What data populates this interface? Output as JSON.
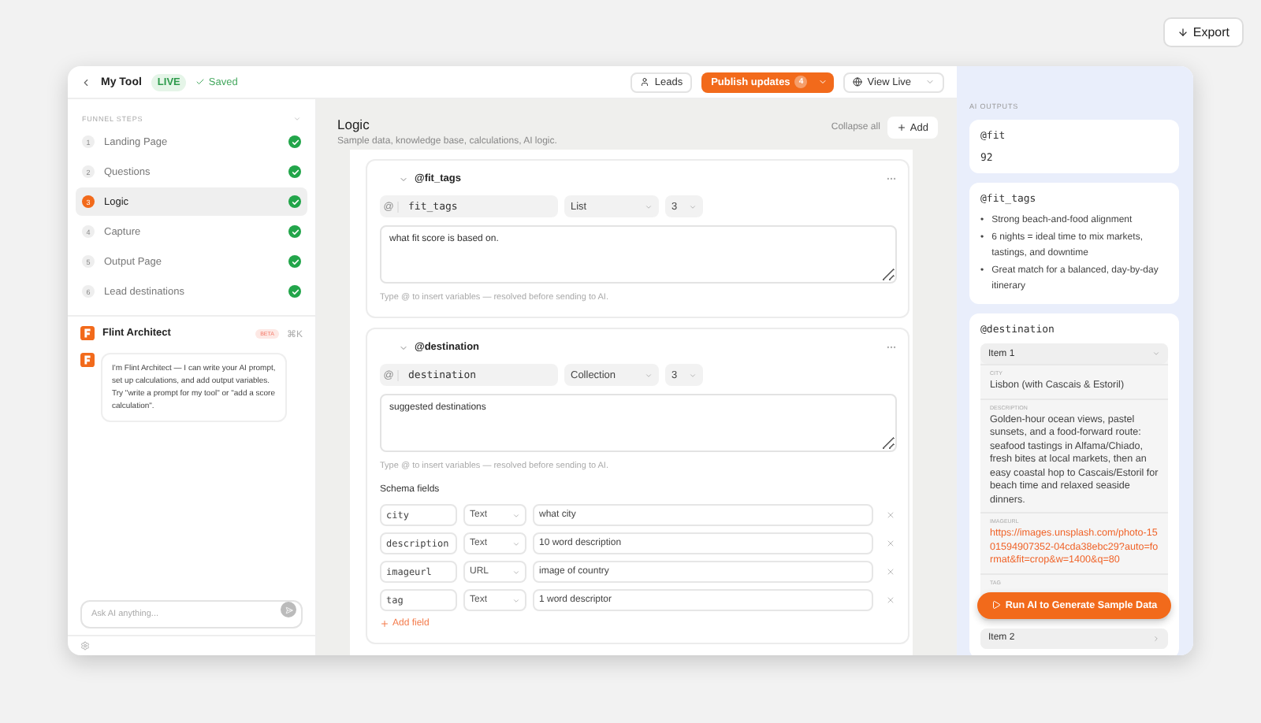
{
  "export_button": "Export",
  "header": {
    "title": "My Tool",
    "status": "LIVE",
    "saved": "Saved",
    "leads": "Leads",
    "publish": "Publish updates",
    "publish_count": "4",
    "view_live": "View Live"
  },
  "sidebar": {
    "section_title": "FUNNEL STEPS",
    "steps": [
      {
        "number": "1",
        "label": "Landing Page",
        "selected": false,
        "done": true
      },
      {
        "number": "2",
        "label": "Questions",
        "selected": false,
        "done": true
      },
      {
        "number": "3",
        "label": "Logic",
        "selected": true,
        "done": true
      },
      {
        "number": "4",
        "label": "Capture",
        "selected": false,
        "done": true
      },
      {
        "number": "5",
        "label": "Output Page",
        "selected": false,
        "done": true
      },
      {
        "number": "6",
        "label": "Lead destinations",
        "selected": false,
        "done": true
      }
    ],
    "assistant": {
      "name": "Flint Architect",
      "badge": "BETA",
      "shortcut": "⌘K",
      "message": "I'm Flint Architect — I can write your AI prompt, set up calculations, and add output variables. Try \"write a prompt for my tool\" or \"add a score calculation\".",
      "input_placeholder": "Ask AI anything..."
    }
  },
  "main": {
    "title": "Logic",
    "subtitle": "Sample data, knowledge base, calculations, AI logic.",
    "collapse_all": "Collapse all",
    "add": "Add",
    "variables": [
      {
        "kind": "list",
        "title": "@fit_tags",
        "at_sign": "@",
        "name": "fit_tags",
        "type": "List",
        "count": "3",
        "prompt": "what fit score is based on.",
        "hint": "Type @ to insert variables — resolved before sending to AI."
      },
      {
        "kind": "collection",
        "title": "@destination",
        "at_sign": "@",
        "name": "destination",
        "type": "Collection",
        "count": "3",
        "prompt": "suggested destinations",
        "hint": "Type @ to insert variables — resolved before sending to AI.",
        "schema_title": "Schema fields",
        "fields": [
          {
            "name": "city",
            "type": "Text",
            "description": "what city"
          },
          {
            "name": "description",
            "type": "Text",
            "description": "10 word description"
          },
          {
            "name": "imageurl",
            "type": "URL",
            "description": "image of country"
          },
          {
            "name": "tag",
            "type": "Text",
            "description": "1 word descriptor"
          }
        ],
        "add_field": "Add field"
      }
    ]
  },
  "outputs": {
    "title": "AI OUTPUTS",
    "cards": [
      {
        "kind": "value",
        "title": "@fit",
        "value": "92"
      },
      {
        "kind": "list",
        "title": "@fit_tags",
        "marker": "•",
        "items": [
          "Strong beach-and-food alignment",
          "6 nights = ideal time to mix markets, tastings, and downtime",
          "Great match for a balanced, day-by-day itinerary"
        ]
      },
      {
        "kind": "collection",
        "title": "@destination",
        "items": [
          {
            "label": "Item 1",
            "expanded": true,
            "fields": [
              {
                "kind": "text",
                "label": "CITY",
                "value": "Lisbon (with Cascais & Estoril)"
              },
              {
                "kind": "text",
                "label": "DESCRIPTION",
                "value": "Golden-hour ocean views, pastel sunsets, and a food-forward route: seafood tastings in Alfama/Chiado, fresh bites at local markets, then an easy coastal hop to Cascais/Estoril for beach time and relaxed seaside dinners."
              },
              {
                "kind": "link",
                "label": "IMAGEURL",
                "value": "https://images.unsplash.com/photo-1501594907352-04cda38ebc29?auto=format&fit=crop&w=1400&q=80"
              },
              {
                "kind": "text",
                "label": "TAG"
              }
            ]
          },
          {
            "label": "Item 2",
            "expanded": false
          }
        ]
      }
    ],
    "run_button": "Run AI to Generate Sample Data"
  }
}
